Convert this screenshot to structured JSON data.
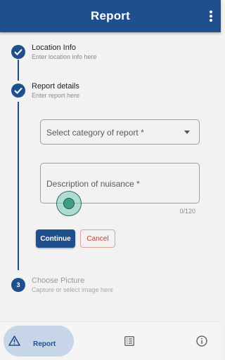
{
  "appbar": {
    "title": "Report"
  },
  "steps": [
    {
      "title": "Location Info",
      "subtitle": "Enter location info here",
      "state": "complete"
    },
    {
      "title": "Report details",
      "subtitle": "Enter report  here",
      "state": "complete"
    },
    {
      "number": "3",
      "title": "Choose Picture",
      "subtitle": "Capture or select image here",
      "state": "pending"
    }
  ],
  "form": {
    "category_placeholder": "Select category of report *",
    "description_placeholder": "Description of nuisance *",
    "char_counter": "0/120",
    "continue_label": "Continue",
    "cancel_label": "Cancel"
  },
  "bottom_nav": {
    "items": [
      {
        "label": "Report",
        "icon": "warning-icon",
        "active": true
      },
      {
        "label": "",
        "icon": "list-icon",
        "active": false
      },
      {
        "label": "",
        "icon": "info-icon",
        "active": false
      }
    ]
  },
  "colors": {
    "primary": "#1f4f8c",
    "cancel": "#c0392b",
    "background": "#f2f2f2"
  }
}
